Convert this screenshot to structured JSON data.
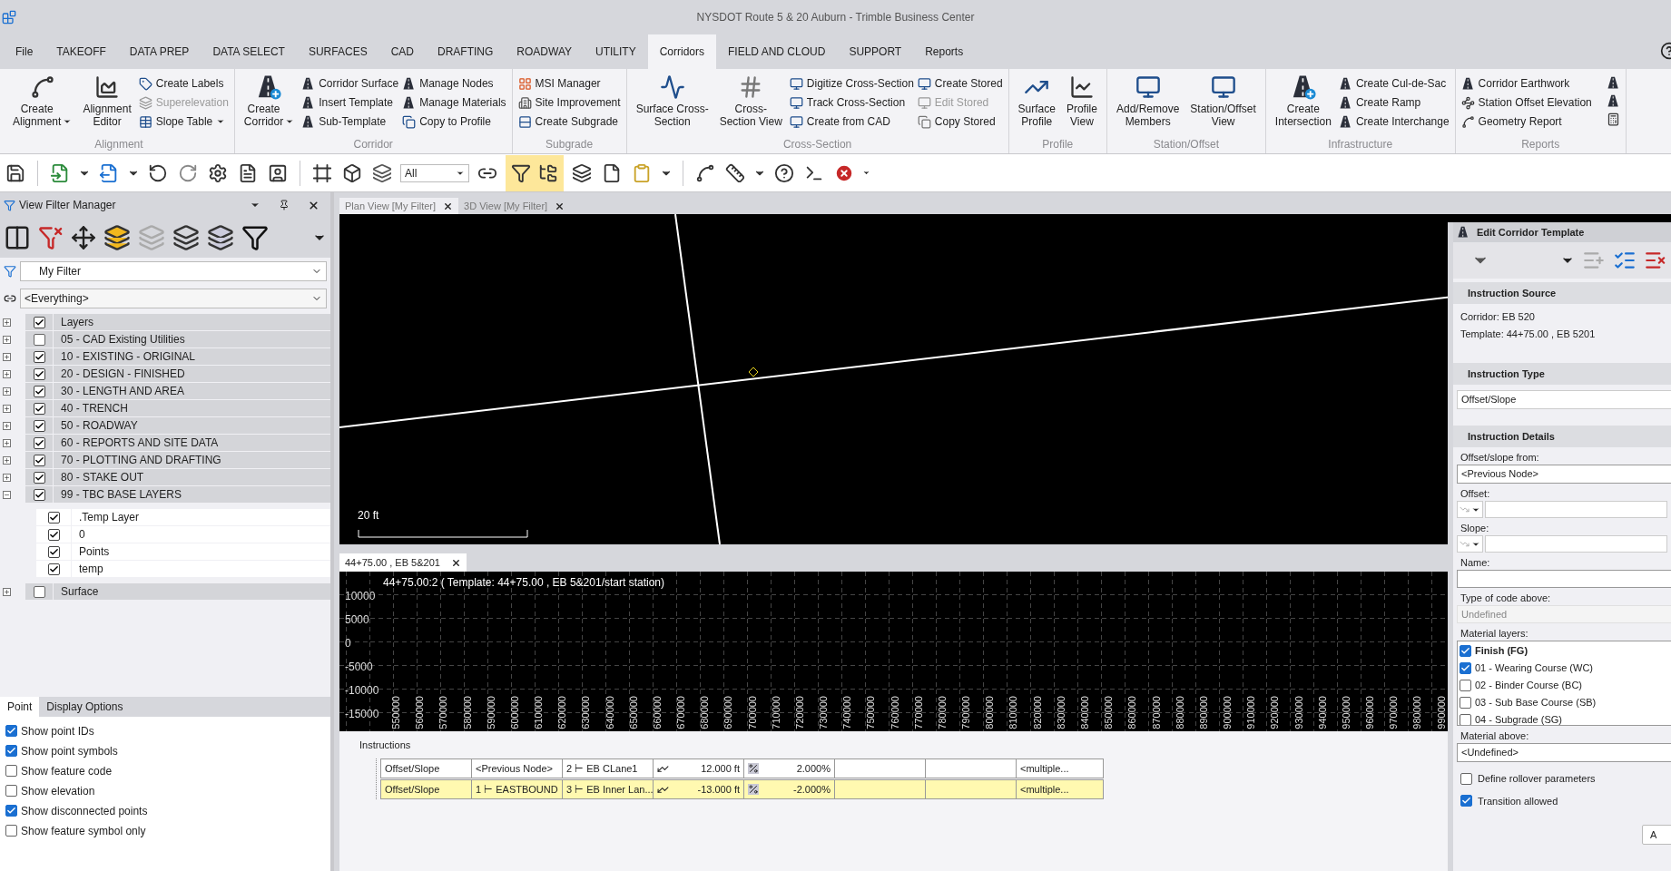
{
  "window": {
    "title": "NYSDOT Route 5 & 20 Auburn - Trimble Business Center"
  },
  "menu_tabs": [
    {
      "label": "File",
      "selected": false
    },
    {
      "label": "TAKEOFF",
      "selected": false
    },
    {
      "label": "DATA PREP",
      "selected": false
    },
    {
      "label": "DATA SELECT",
      "selected": false
    },
    {
      "label": "SURFACES",
      "selected": false
    },
    {
      "label": "CAD",
      "selected": false
    },
    {
      "label": "DRAFTING",
      "selected": false
    },
    {
      "label": "ROADWAY",
      "selected": false
    },
    {
      "label": "UTILITY",
      "selected": false
    },
    {
      "label": "Corridors",
      "selected": true
    },
    {
      "label": "FIELD AND CLOUD",
      "selected": false
    },
    {
      "label": "SUPPORT",
      "selected": false
    },
    {
      "label": "Reports",
      "selected": false
    }
  ],
  "ribbon": {
    "groups": [
      {
        "label": "Alignment",
        "items": [
          {
            "kind": "large",
            "label": "Create\nAlignment",
            "dropdown": true
          },
          {
            "kind": "large",
            "label": "Alignment\nEditor",
            "dropdown": false
          },
          {
            "kind": "stack",
            "buttons": [
              {
                "label": "Create Labels",
                "disabled": false,
                "dropdown": false
              },
              {
                "label": "Superelevation",
                "disabled": true,
                "dropdown": false
              },
              {
                "label": "Slope Table",
                "disabled": false,
                "dropdown": true
              }
            ]
          }
        ]
      },
      {
        "label": "Corridor",
        "items": [
          {
            "kind": "large",
            "label": "Create\nCorridor",
            "dropdown": true
          },
          {
            "kind": "stack",
            "buttons": [
              {
                "label": "Corridor Surface",
                "disabled": false,
                "dropdown": false
              },
              {
                "label": "Insert Template",
                "disabled": false,
                "dropdown": false
              },
              {
                "label": "Sub-Template",
                "disabled": false,
                "dropdown": false
              }
            ]
          },
          {
            "kind": "stack",
            "buttons": [
              {
                "label": "Manage Nodes",
                "disabled": false,
                "dropdown": false
              },
              {
                "label": "Manage Materials",
                "disabled": false,
                "dropdown": false
              },
              {
                "label": "Copy to Profile",
                "disabled": false,
                "dropdown": false
              }
            ]
          }
        ]
      },
      {
        "label": "Subgrade",
        "items": [
          {
            "kind": "stack",
            "buttons": [
              {
                "label": "MSI Manager",
                "disabled": false,
                "dropdown": false
              },
              {
                "label": "Site Improvement",
                "disabled": false,
                "dropdown": false
              },
              {
                "label": "Create Subgrade",
                "disabled": false,
                "dropdown": false
              }
            ]
          }
        ]
      },
      {
        "label": "Cross-Section",
        "items": [
          {
            "kind": "large",
            "label": "Surface Cross-\nSection",
            "dropdown": false
          },
          {
            "kind": "large",
            "label": "Cross-\nSection View",
            "dropdown": false
          },
          {
            "kind": "stack",
            "buttons": [
              {
                "label": "Digitize Cross-Section",
                "disabled": false,
                "dropdown": false
              },
              {
                "label": "Track Cross-Section",
                "disabled": false,
                "dropdown": false
              },
              {
                "label": "Create from CAD",
                "disabled": false,
                "dropdown": false
              }
            ]
          },
          {
            "kind": "stack",
            "buttons": [
              {
                "label": "Create Stored",
                "disabled": false,
                "dropdown": false
              },
              {
                "label": "Edit Stored",
                "disabled": true,
                "dropdown": false
              },
              {
                "label": "Copy Stored",
                "disabled": false,
                "dropdown": false
              }
            ]
          }
        ]
      },
      {
        "label": "Profile",
        "items": [
          {
            "kind": "large",
            "label": "Surface\nProfile",
            "dropdown": false
          },
          {
            "kind": "large",
            "label": "Profile\nView",
            "dropdown": false
          }
        ]
      },
      {
        "label": "Station/Offset",
        "items": [
          {
            "kind": "large",
            "label": "Add/Remove\nMembers",
            "dropdown": false
          },
          {
            "kind": "large",
            "label": "Station/Offset\nView",
            "dropdown": false
          }
        ]
      },
      {
        "label": "Infrastructure",
        "items": [
          {
            "kind": "large",
            "label": "Create\nIntersection",
            "dropdown": false
          },
          {
            "kind": "stack",
            "buttons": [
              {
                "label": "Create Cul-de-Sac",
                "disabled": false,
                "dropdown": false
              },
              {
                "label": "Create Ramp",
                "disabled": false,
                "dropdown": false
              },
              {
                "label": "Create Interchange",
                "disabled": false,
                "dropdown": false
              }
            ]
          }
        ]
      },
      {
        "label": "Reports",
        "items": [
          {
            "kind": "stack",
            "buttons": [
              {
                "label": "Corridor Earthwork",
                "disabled": false,
                "dropdown": false
              },
              {
                "label": "Station Offset Elevation",
                "disabled": false,
                "dropdown": false
              },
              {
                "label": "Geometry Report",
                "disabled": false,
                "dropdown": false
              }
            ]
          },
          {
            "kind": "icon_stack"
          }
        ]
      }
    ]
  },
  "toolbar": {
    "layer_select": {
      "value": "All"
    }
  },
  "filter_panel": {
    "title": "View Filter Manager",
    "filter": {
      "value": "My Filter"
    },
    "scope": {
      "value": "<Everything>"
    },
    "tree": [
      {
        "label": "Layers",
        "checked": true,
        "expanded": false
      },
      {
        "label": "05 - CAD Existing Utilities",
        "checked": false,
        "expanded": false
      },
      {
        "label": "10 - EXISTING - ORIGINAL",
        "checked": true,
        "expanded": false
      },
      {
        "label": "20 - DESIGN - FINISHED",
        "checked": true,
        "expanded": false
      },
      {
        "label": "30 - LENGTH AND AREA",
        "checked": true,
        "expanded": false
      },
      {
        "label": "40 - TRENCH",
        "checked": true,
        "expanded": false
      },
      {
        "label": "50 - ROADWAY",
        "checked": true,
        "expanded": false
      },
      {
        "label": "60 - REPORTS AND SITE DATA",
        "checked": true,
        "expanded": false
      },
      {
        "label": "70 - PLOTTING AND DRAFTING",
        "checked": true,
        "expanded": false
      },
      {
        "label": "80 - STAKE OUT",
        "checked": true,
        "expanded": false
      },
      {
        "label": "99 - TBC BASE LAYERS",
        "checked": true,
        "expanded": true,
        "children": [
          {
            "label": ".Temp Layer",
            "checked": true
          },
          {
            "label": "0",
            "checked": true
          },
          {
            "label": "Points",
            "checked": true
          },
          {
            "label": "temp",
            "checked": true
          }
        ]
      },
      {
        "label": "Surface",
        "checked": false,
        "expanded": false
      }
    ],
    "tabs": [
      {
        "label": "Point",
        "selected": true
      },
      {
        "label": "Display Options",
        "selected": false
      }
    ],
    "options": [
      {
        "label": "Show point IDs",
        "checked": true
      },
      {
        "label": "Show point symbols",
        "checked": true
      },
      {
        "label": "Show feature code",
        "checked": false
      },
      {
        "label": "Show elevation",
        "checked": false
      },
      {
        "label": "Show disconnected points",
        "checked": true
      },
      {
        "label": "Show feature symbol only",
        "checked": false
      }
    ]
  },
  "plan_view": {
    "tabs": [
      {
        "label": "Plan View [My Filter]",
        "selected": true
      },
      {
        "label": "3D View [My Filter]",
        "selected": false
      }
    ],
    "scale_label": "20 ft"
  },
  "cross_section": {
    "tab": "44+75.00 , EB 5&201",
    "caption": "44+75.00:2 ( Template: 44+75.00 , EB 5&201/start station)",
    "y_labels": [
      "10000",
      "5000",
      "0",
      "-5000",
      "-10000",
      "-15000"
    ],
    "x_labels": [
      "550000",
      "560000",
      "570000",
      "580000",
      "590000",
      "600000",
      "610000",
      "620000",
      "630000",
      "640000",
      "650000",
      "660000",
      "670000",
      "680000",
      "690000",
      "700000",
      "710000",
      "720000",
      "730000",
      "740000",
      "750000",
      "760000",
      "770000",
      "780000",
      "790000",
      "800000",
      "810000",
      "820000",
      "830000",
      "840000",
      "850000",
      "860000",
      "870000",
      "880000",
      "890000",
      "900000",
      "910000",
      "920000",
      "930000",
      "940000",
      "950000",
      "960000",
      "970000",
      "980000",
      "990000"
    ]
  },
  "instructions": {
    "title": "Instructions",
    "rows": [
      {
        "selected": false,
        "type": "Offset/Slope",
        "from": "<Previous Node>",
        "node": "2 ⊢ EB CLane1",
        "offset": "12.000 ft",
        "slope": "2.000%",
        "material": "<multiple..."
      },
      {
        "selected": true,
        "type": "Offset/Slope",
        "from": "1 ⊢ EASTBOUND",
        "node": "3 ⊢ EB Inner Lan...",
        "offset": "-13.000 ft",
        "slope": "-2.000%",
        "material": "<multiple..."
      }
    ]
  },
  "template_editor": {
    "title": "Edit Corridor Template",
    "source": {
      "heading": "Instruction Source",
      "lines": [
        "Corridor: EB 520",
        "Template: 44+75.00 , EB 5201"
      ]
    },
    "type": {
      "heading": "Instruction Type",
      "value": "Offset/Slope"
    },
    "details": {
      "heading": "Instruction Details",
      "fields": [
        {
          "kind": "select",
          "label": "Offset/slope from:",
          "value": "<Previous Node>"
        },
        {
          "kind": "unit_input",
          "label": "Offset:"
        },
        {
          "kind": "unit_input",
          "label": "Slope:"
        },
        {
          "kind": "input",
          "label": "Name:"
        },
        {
          "kind": "readonly",
          "label": "Type of code above:",
          "value": "Undefined"
        },
        {
          "kind": "checklist",
          "label": "Material layers:",
          "items": [
            {
              "label": "Finish (FG)",
              "checked": true,
              "bold": true
            },
            {
              "label": "01 - Wearing Course (WC)",
              "checked": true,
              "bold": false
            },
            {
              "label": "02 - Binder Course (BC)",
              "checked": false,
              "bold": false
            },
            {
              "label": "03 - Sub Base Course (SB)",
              "checked": false,
              "bold": false
            },
            {
              "label": "04 - Subgrade (SG)",
              "checked": false,
              "bold": false
            }
          ]
        },
        {
          "kind": "select",
          "label": "Material above:",
          "value": "<Undefined>"
        }
      ]
    },
    "checkboxes": [
      {
        "label": "Define rollover parameters",
        "checked": false
      },
      {
        "label": "Transition allowed",
        "checked": true
      }
    ],
    "button": "A"
  }
}
